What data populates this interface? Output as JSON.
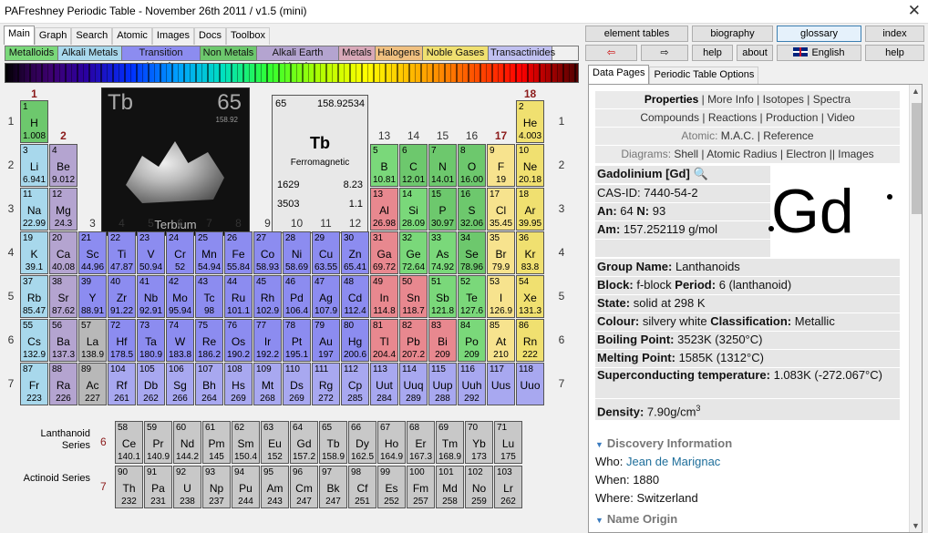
{
  "window": {
    "title": "PAFreshney Periodic Table - November 26th 2011 / v1.5 (mini)",
    "close": "✕"
  },
  "main_tabs": [
    "Main",
    "Graph",
    "Search",
    "Atomic",
    "Images",
    "Docs",
    "Toolbox"
  ],
  "categories": [
    {
      "label": "Metalloids",
      "color": "#7ad87a"
    },
    {
      "label": "Alkali Metals",
      "color": "#a8d8ec"
    },
    {
      "label": "Transition Metals",
      "color": "#8c8cf0"
    },
    {
      "label": "Non Metals",
      "color": "#6dc86d"
    },
    {
      "label": "Alkali Earth Metals",
      "color": "#b4a4d0"
    },
    {
      "label": "Metals",
      "color": "#d8a8b8"
    },
    {
      "label": "Halogens",
      "color": "#f0c080"
    },
    {
      "label": "Noble Gases",
      "color": "#f0e070"
    },
    {
      "label": "Transactinides",
      "color": "#c0c0f0"
    }
  ],
  "groups": [
    "1",
    "2",
    "3",
    "4",
    "5",
    "6",
    "7",
    "8",
    "9",
    "10",
    "11",
    "12",
    "13",
    "14",
    "15",
    "16",
    "17",
    "18"
  ],
  "periods": [
    "1",
    "2",
    "3",
    "4",
    "5",
    "6",
    "7"
  ],
  "photo": {
    "symbol": "Tb",
    "number": "65",
    "mass": "158.92",
    "name": "Terbium"
  },
  "selected": {
    "number": "65",
    "mass": "158.92534",
    "symbol": "Tb",
    "desc": "Ferromagnetic",
    "v1": "1629",
    "v2": "8.23",
    "v3": "3503",
    "v4": "1.1"
  },
  "elements": [
    {
      "z": "1",
      "s": "H",
      "m": "1.008",
      "c": "hydrogen",
      "col": 1,
      "row": 1
    },
    {
      "z": "2",
      "s": "He",
      "m": "4.003",
      "c": "noble",
      "col": 18,
      "row": 1
    },
    {
      "z": "3",
      "s": "Li",
      "m": "6.941",
      "c": "alkali",
      "col": 1,
      "row": 2
    },
    {
      "z": "4",
      "s": "Be",
      "m": "9.012",
      "c": "alkearth",
      "col": 2,
      "row": 2
    },
    {
      "z": "5",
      "s": "B",
      "m": "10.81",
      "c": "metalloid",
      "col": 13,
      "row": 2
    },
    {
      "z": "6",
      "s": "C",
      "m": "12.01",
      "c": "nonmetal",
      "col": 14,
      "row": 2
    },
    {
      "z": "7",
      "s": "N",
      "m": "14.01",
      "c": "nonmetal",
      "col": 15,
      "row": 2
    },
    {
      "z": "8",
      "s": "O",
      "m": "16.00",
      "c": "nonmetal",
      "col": 16,
      "row": 2
    },
    {
      "z": "9",
      "s": "F",
      "m": "19",
      "c": "halogen",
      "col": 17,
      "row": 2
    },
    {
      "z": "10",
      "s": "Ne",
      "m": "20.18",
      "c": "noble",
      "col": 18,
      "row": 2
    },
    {
      "z": "11",
      "s": "Na",
      "m": "22.99",
      "c": "alkali",
      "col": 1,
      "row": 3
    },
    {
      "z": "12",
      "s": "Mg",
      "m": "24.3",
      "c": "alkearth",
      "col": 2,
      "row": 3
    },
    {
      "z": "13",
      "s": "Al",
      "m": "26.98",
      "c": "metalred",
      "col": 13,
      "row": 3
    },
    {
      "z": "14",
      "s": "Si",
      "m": "28.09",
      "c": "metalloid",
      "col": 14,
      "row": 3
    },
    {
      "z": "15",
      "s": "P",
      "m": "30.97",
      "c": "nonmetal",
      "col": 15,
      "row": 3
    },
    {
      "z": "16",
      "s": "S",
      "m": "32.06",
      "c": "nonmetal",
      "col": 16,
      "row": 3
    },
    {
      "z": "17",
      "s": "Cl",
      "m": "35.45",
      "c": "halogen",
      "col": 17,
      "row": 3
    },
    {
      "z": "18",
      "s": "Ar",
      "m": "39.95",
      "c": "noble",
      "col": 18,
      "row": 3
    },
    {
      "z": "19",
      "s": "K",
      "m": "39.1",
      "c": "alkali",
      "col": 1,
      "row": 4
    },
    {
      "z": "20",
      "s": "Ca",
      "m": "40.08",
      "c": "alkearth",
      "col": 2,
      "row": 4
    },
    {
      "z": "21",
      "s": "Sc",
      "m": "44.96",
      "c": "trans",
      "col": 3,
      "row": 4
    },
    {
      "z": "22",
      "s": "Ti",
      "m": "47.87",
      "c": "trans",
      "col": 4,
      "row": 4
    },
    {
      "z": "23",
      "s": "V",
      "m": "50.94",
      "c": "trans",
      "col": 5,
      "row": 4
    },
    {
      "z": "24",
      "s": "Cr",
      "m": "52",
      "c": "trans",
      "col": 6,
      "row": 4
    },
    {
      "z": "25",
      "s": "Mn",
      "m": "54.94",
      "c": "trans",
      "col": 7,
      "row": 4
    },
    {
      "z": "26",
      "s": "Fe",
      "m": "55.84",
      "c": "trans",
      "col": 8,
      "row": 4
    },
    {
      "z": "27",
      "s": "Co",
      "m": "58.93",
      "c": "trans",
      "col": 9,
      "row": 4
    },
    {
      "z": "28",
      "s": "Ni",
      "m": "58.69",
      "c": "trans",
      "col": 10,
      "row": 4
    },
    {
      "z": "29",
      "s": "Cu",
      "m": "63.55",
      "c": "trans",
      "col": 11,
      "row": 4
    },
    {
      "z": "30",
      "s": "Zn",
      "m": "65.41",
      "c": "trans",
      "col": 12,
      "row": 4
    },
    {
      "z": "31",
      "s": "Ga",
      "m": "69.72",
      "c": "metalred",
      "col": 13,
      "row": 4
    },
    {
      "z": "32",
      "s": "Ge",
      "m": "72.64",
      "c": "metalloid",
      "col": 14,
      "row": 4
    },
    {
      "z": "33",
      "s": "As",
      "m": "74.92",
      "c": "metalloid",
      "col": 15,
      "row": 4
    },
    {
      "z": "34",
      "s": "Se",
      "m": "78.96",
      "c": "nonmetal",
      "col": 16,
      "row": 4
    },
    {
      "z": "35",
      "s": "Br",
      "m": "79.9",
      "c": "halogen",
      "col": 17,
      "row": 4
    },
    {
      "z": "36",
      "s": "Kr",
      "m": "83.8",
      "c": "noble",
      "col": 18,
      "row": 4
    },
    {
      "z": "37",
      "s": "Rb",
      "m": "85.47",
      "c": "alkali",
      "col": 1,
      "row": 5
    },
    {
      "z": "38",
      "s": "Sr",
      "m": "87.62",
      "c": "alkearth",
      "col": 2,
      "row": 5
    },
    {
      "z": "39",
      "s": "Y",
      "m": "88.91",
      "c": "trans",
      "col": 3,
      "row": 5
    },
    {
      "z": "40",
      "s": "Zr",
      "m": "91.22",
      "c": "trans",
      "col": 4,
      "row": 5
    },
    {
      "z": "41",
      "s": "Nb",
      "m": "92.91",
      "c": "trans",
      "col": 5,
      "row": 5
    },
    {
      "z": "42",
      "s": "Mo",
      "m": "95.94",
      "c": "trans",
      "col": 6,
      "row": 5
    },
    {
      "z": "43",
      "s": "Tc",
      "m": "98",
      "c": "trans",
      "col": 7,
      "row": 5
    },
    {
      "z": "44",
      "s": "Ru",
      "m": "101.1",
      "c": "trans",
      "col": 8,
      "row": 5
    },
    {
      "z": "45",
      "s": "Rh",
      "m": "102.9",
      "c": "trans",
      "col": 9,
      "row": 5
    },
    {
      "z": "46",
      "s": "Pd",
      "m": "106.4",
      "c": "trans",
      "col": 10,
      "row": 5
    },
    {
      "z": "47",
      "s": "Ag",
      "m": "107.9",
      "c": "trans",
      "col": 11,
      "row": 5
    },
    {
      "z": "48",
      "s": "Cd",
      "m": "112.4",
      "c": "trans",
      "col": 12,
      "row": 5
    },
    {
      "z": "49",
      "s": "In",
      "m": "114.8",
      "c": "metalred",
      "col": 13,
      "row": 5
    },
    {
      "z": "50",
      "s": "Sn",
      "m": "118.7",
      "c": "metalred",
      "col": 14,
      "row": 5
    },
    {
      "z": "51",
      "s": "Sb",
      "m": "121.8",
      "c": "metalloid",
      "col": 15,
      "row": 5
    },
    {
      "z": "52",
      "s": "Te",
      "m": "127.6",
      "c": "metalloid",
      "col": 16,
      "row": 5
    },
    {
      "z": "53",
      "s": "I",
      "m": "126.9",
      "c": "halogen",
      "col": 17,
      "row": 5
    },
    {
      "z": "54",
      "s": "Xe",
      "m": "131.3",
      "c": "noble",
      "col": 18,
      "row": 5
    },
    {
      "z": "55",
      "s": "Cs",
      "m": "132.9",
      "c": "alkali",
      "col": 1,
      "row": 6
    },
    {
      "z": "56",
      "s": "Ba",
      "m": "137.3",
      "c": "alkearth",
      "col": 2,
      "row": 6
    },
    {
      "z": "57",
      "s": "La",
      "m": "138.9",
      "c": "post",
      "col": 3,
      "row": 6
    },
    {
      "z": "72",
      "s": "Hf",
      "m": "178.5",
      "c": "trans",
      "col": 4,
      "row": 6
    },
    {
      "z": "73",
      "s": "Ta",
      "m": "180.9",
      "c": "trans",
      "col": 5,
      "row": 6
    },
    {
      "z": "74",
      "s": "W",
      "m": "183.8",
      "c": "trans",
      "col": 6,
      "row": 6
    },
    {
      "z": "75",
      "s": "Re",
      "m": "186.2",
      "c": "trans",
      "col": 7,
      "row": 6
    },
    {
      "z": "76",
      "s": "Os",
      "m": "190.2",
      "c": "trans",
      "col": 8,
      "row": 6
    },
    {
      "z": "77",
      "s": "Ir",
      "m": "192.2",
      "c": "trans",
      "col": 9,
      "row": 6
    },
    {
      "z": "78",
      "s": "Pt",
      "m": "195.1",
      "c": "trans",
      "col": 10,
      "row": 6
    },
    {
      "z": "79",
      "s": "Au",
      "m": "197",
      "c": "trans",
      "col": 11,
      "row": 6
    },
    {
      "z": "80",
      "s": "Hg",
      "m": "200.6",
      "c": "trans",
      "col": 12,
      "row": 6
    },
    {
      "z": "81",
      "s": "Tl",
      "m": "204.4",
      "c": "metalred",
      "col": 13,
      "row": 6
    },
    {
      "z": "82",
      "s": "Pb",
      "m": "207.2",
      "c": "metalred",
      "col": 14,
      "row": 6
    },
    {
      "z": "83",
      "s": "Bi",
      "m": "209",
      "c": "metalred",
      "col": 15,
      "row": 6
    },
    {
      "z": "84",
      "s": "Po",
      "m": "209",
      "c": "metalloid",
      "col": 16,
      "row": 6
    },
    {
      "z": "85",
      "s": "At",
      "m": "210",
      "c": "halogen",
      "col": 17,
      "row": 6
    },
    {
      "z": "86",
      "s": "Rn",
      "m": "222",
      "c": "noble",
      "col": 18,
      "row": 6
    },
    {
      "z": "87",
      "s": "Fr",
      "m": "223",
      "c": "alkali",
      "col": 1,
      "row": 7
    },
    {
      "z": "88",
      "s": "Ra",
      "m": "226",
      "c": "alkearth",
      "col": 2,
      "row": 7
    },
    {
      "z": "89",
      "s": "Ac",
      "m": "227",
      "c": "post",
      "col": 3,
      "row": 7
    },
    {
      "z": "104",
      "s": "Rf",
      "m": "261",
      "c": "transact",
      "col": 4,
      "row": 7
    },
    {
      "z": "105",
      "s": "Db",
      "m": "262",
      "c": "transact",
      "col": 5,
      "row": 7
    },
    {
      "z": "106",
      "s": "Sg",
      "m": "266",
      "c": "transact",
      "col": 6,
      "row": 7
    },
    {
      "z": "107",
      "s": "Bh",
      "m": "264",
      "c": "transact",
      "col": 7,
      "row": 7
    },
    {
      "z": "108",
      "s": "Hs",
      "m": "269",
      "c": "transact",
      "col": 8,
      "row": 7
    },
    {
      "z": "109",
      "s": "Mt",
      "m": "268",
      "c": "transact",
      "col": 9,
      "row": 7
    },
    {
      "z": "110",
      "s": "Ds",
      "m": "269",
      "c": "transact",
      "col": 10,
      "row": 7
    },
    {
      "z": "111",
      "s": "Rg",
      "m": "272",
      "c": "transact",
      "col": 11,
      "row": 7
    },
    {
      "z": "112",
      "s": "Cp",
      "m": "285",
      "c": "transact",
      "col": 12,
      "row": 7
    },
    {
      "z": "113",
      "s": "Uut",
      "m": "284",
      "c": "transact",
      "col": 13,
      "row": 7
    },
    {
      "z": "114",
      "s": "Uuq",
      "m": "289",
      "c": "transact",
      "col": 14,
      "row": 7
    },
    {
      "z": "115",
      "s": "Uup",
      "m": "288",
      "c": "transact",
      "col": 15,
      "row": 7
    },
    {
      "z": "116",
      "s": "Uuh",
      "m": "292",
      "c": "transact",
      "col": 16,
      "row": 7
    },
    {
      "z": "117",
      "s": "Uus",
      "m": "",
      "c": "transact",
      "col": 17,
      "row": 7
    },
    {
      "z": "118",
      "s": "Uuo",
      "m": "",
      "c": "transact",
      "col": 18,
      "row": 7
    }
  ],
  "lanthanoids": {
    "label": "Lanthanoid Series",
    "num": "6",
    "items": [
      {
        "z": "58",
        "s": "Ce",
        "m": "140.1"
      },
      {
        "z": "59",
        "s": "Pr",
        "m": "140.9"
      },
      {
        "z": "60",
        "s": "Nd",
        "m": "144.2"
      },
      {
        "z": "61",
        "s": "Pm",
        "m": "145"
      },
      {
        "z": "62",
        "s": "Sm",
        "m": "150.4"
      },
      {
        "z": "63",
        "s": "Eu",
        "m": "152"
      },
      {
        "z": "64",
        "s": "Gd",
        "m": "157.2"
      },
      {
        "z": "65",
        "s": "Tb",
        "m": "158.9"
      },
      {
        "z": "66",
        "s": "Dy",
        "m": "162.5"
      },
      {
        "z": "67",
        "s": "Ho",
        "m": "164.9"
      },
      {
        "z": "68",
        "s": "Er",
        "m": "167.3"
      },
      {
        "z": "69",
        "s": "Tm",
        "m": "168.9"
      },
      {
        "z": "70",
        "s": "Yb",
        "m": "173"
      },
      {
        "z": "71",
        "s": "Lu",
        "m": "175"
      }
    ]
  },
  "actinoids": {
    "label": "Actinoid Series",
    "num": "7",
    "items": [
      {
        "z": "90",
        "s": "Th",
        "m": "232"
      },
      {
        "z": "91",
        "s": "Pa",
        "m": "231"
      },
      {
        "z": "92",
        "s": "U",
        "m": "238"
      },
      {
        "z": "93",
        "s": "Np",
        "m": "237"
      },
      {
        "z": "94",
        "s": "Pu",
        "m": "244"
      },
      {
        "z": "95",
        "s": "Am",
        "m": "243"
      },
      {
        "z": "96",
        "s": "Cm",
        "m": "247"
      },
      {
        "z": "97",
        "s": "Bk",
        "m": "247"
      },
      {
        "z": "98",
        "s": "Cf",
        "m": "251"
      },
      {
        "z": "99",
        "s": "Es",
        "m": "252"
      },
      {
        "z": "100",
        "s": "Fm",
        "m": "257"
      },
      {
        "z": "101",
        "s": "Md",
        "m": "258"
      },
      {
        "z": "102",
        "s": "No",
        "m": "259"
      },
      {
        "z": "103",
        "s": "Lr",
        "m": "262"
      }
    ]
  },
  "right": {
    "buttons": {
      "element_tables": "element tables",
      "biography": "biography",
      "glossary": "glossary",
      "index": "index",
      "back": "⇦",
      "forward": "⇨",
      "help": "help",
      "about": "about",
      "english": "English",
      "help2": "help"
    },
    "tabs": [
      "Data Pages",
      "Periodic Table Options"
    ],
    "nav1": {
      "properties": "Properties",
      "more_info": "More Info",
      "isotopes": "Isotopes",
      "spectra": "Spectra"
    },
    "nav2": {
      "compounds": "Compounds",
      "reactions": "Reactions",
      "production": "Production",
      "video": "Video"
    },
    "nav3": {
      "atomic": "Atomic:",
      "mac": "M.A.C.",
      "reference": "Reference"
    },
    "nav4": {
      "diagrams": "Diagrams:",
      "shell": "Shell",
      "radius": "Atomic Radius",
      "electron": "Electron",
      "images": "Images"
    },
    "element": {
      "name": "Gadolinium [Gd]",
      "cas": "CAS-ID: 7440-54-2",
      "an": "An:",
      "an_val": "64",
      "n": "N:",
      "n_val": "93",
      "am": "Am:",
      "am_val": "157.252119 g/mol",
      "symbol": "Gd"
    },
    "props": [
      {
        "k": "Group Name:",
        "v": "Lanthanoids"
      },
      {
        "k": "Block:",
        "v": "f-block",
        "k2": "Period:",
        "v2": "6 (lanthanoid)"
      },
      {
        "k": "State:",
        "v": "solid at 298 K"
      },
      {
        "k": "Colour:",
        "v": "silvery white",
        "k2": "Classification:",
        "v2": "Metallic"
      },
      {
        "k": "Boiling Point:",
        "v": "3523K (3250°C)"
      },
      {
        "k": "Melting Point:",
        "v": "1585K (1312°C)"
      },
      {
        "k": "Superconducting temperature:",
        "v": "1.083K (-272.067°C)"
      },
      {
        "k": "Density:",
        "v": "7.90g/cm"
      }
    ],
    "discovery": {
      "head": "Discovery Information",
      "who_k": "Who:",
      "who_v": "Jean de Marignac",
      "when_k": "When:",
      "when_v": "1880",
      "where_k": "Where:",
      "where_v": "Switzerland"
    },
    "name_origin": "Name Origin"
  }
}
